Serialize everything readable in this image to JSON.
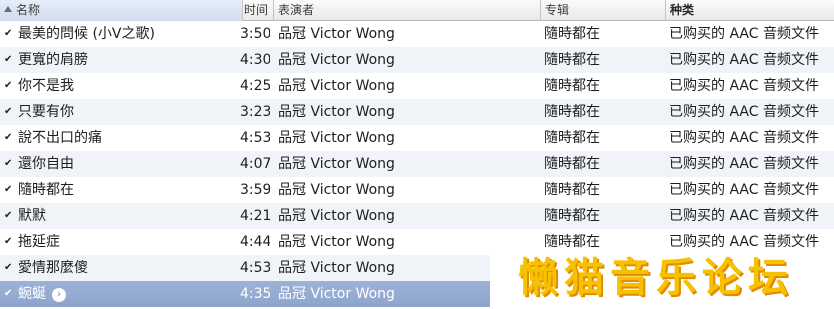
{
  "columns": {
    "name": "名称",
    "time": "时间",
    "artist": "表演者",
    "album": "专辑",
    "kind": "种类"
  },
  "tracks": [
    {
      "name": "最美的問候 (小V之歌)",
      "time": "3:50",
      "artist": "品冠 Victor Wong",
      "album": "隨時都在",
      "kind": "已购买的 AAC 音频文件",
      "checked": true
    },
    {
      "name": "更寬的肩膀",
      "time": "4:30",
      "artist": "品冠 Victor Wong",
      "album": "隨時都在",
      "kind": "已购买的 AAC 音频文件",
      "checked": true
    },
    {
      "name": "你不是我",
      "time": "4:25",
      "artist": "品冠 Victor Wong",
      "album": "隨時都在",
      "kind": "已购买的 AAC 音频文件",
      "checked": true
    },
    {
      "name": "只要有你",
      "time": "3:23",
      "artist": "品冠 Victor Wong",
      "album": "隨時都在",
      "kind": "已购买的 AAC 音频文件",
      "checked": true
    },
    {
      "name": "說不出口的痛",
      "time": "4:53",
      "artist": "品冠 Victor Wong",
      "album": "隨時都在",
      "kind": "已购买的 AAC 音频文件",
      "checked": true
    },
    {
      "name": "還你自由",
      "time": "4:07",
      "artist": "品冠 Victor Wong",
      "album": "隨時都在",
      "kind": "已购买的 AAC 音频文件",
      "checked": true
    },
    {
      "name": "隨時都在",
      "time": "3:59",
      "artist": "品冠 Victor Wong",
      "album": "隨時都在",
      "kind": "已购买的 AAC 音频文件",
      "checked": true
    },
    {
      "name": "默默",
      "time": "4:21",
      "artist": "品冠 Victor Wong",
      "album": "隨時都在",
      "kind": "已购买的 AAC 音频文件",
      "checked": true
    },
    {
      "name": "拖延症",
      "time": "4:44",
      "artist": "品冠 Victor Wong",
      "album": "隨時都在",
      "kind": "已购买的 AAC 音频文件",
      "checked": true
    },
    {
      "name": "愛情那麼傻",
      "time": "4:53",
      "artist": "品冠 Victor Wong",
      "album": "",
      "kind": "",
      "checked": true
    },
    {
      "name": "蜿蜒",
      "time": "4:35",
      "artist": "品冠 Victor Wong",
      "album": "",
      "kind": "",
      "checked": true,
      "selected": true
    }
  ],
  "watermark": "懒猫音乐论坛",
  "colors": {
    "row_alt": "#f0f4f9",
    "selected_row": "#8ea5cc",
    "watermark": "#f6c200"
  },
  "icons": {
    "check": "checkmark-icon",
    "goto": "circle-arrow-right-icon",
    "sort": "sort-ascending-icon"
  }
}
